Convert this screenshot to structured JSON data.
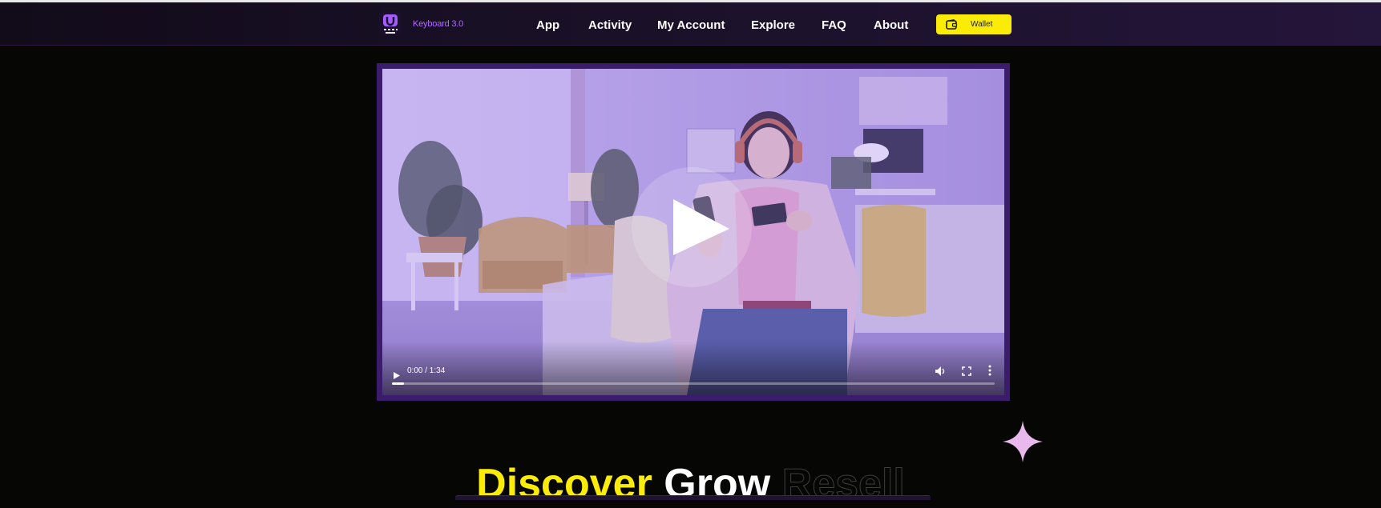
{
  "header": {
    "brand": "Keyboard 3.0",
    "logo_icon": "keyboard-u-logo-icon",
    "nav": [
      {
        "label": "App"
      },
      {
        "label": "Activity"
      },
      {
        "label": "My Account"
      },
      {
        "label": "Explore"
      },
      {
        "label": "FAQ"
      },
      {
        "label": "About"
      }
    ],
    "wallet": {
      "label": "Wallet",
      "icon": "wallet-icon"
    }
  },
  "video": {
    "time": "0:00 / 1:34",
    "progress": 0.02,
    "icons": [
      "play-icon",
      "volume-icon",
      "fullscreen-icon",
      "more-vert-icon"
    ]
  },
  "hero": {
    "words": [
      "Discover",
      "Grow",
      "Resell"
    ],
    "decoration_icon": "sparkle-icon"
  },
  "colors": {
    "accent_yellow": "#fbec08",
    "brand_purple": "#b06cff",
    "frame_purple": "#3b1b6b",
    "background": "#060604"
  }
}
